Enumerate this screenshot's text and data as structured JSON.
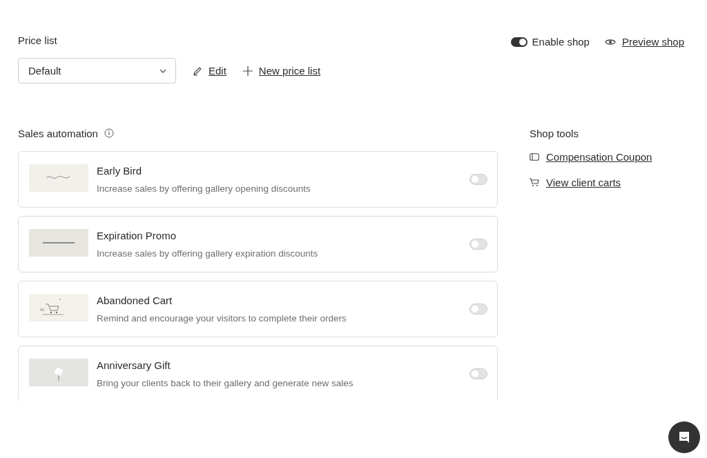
{
  "price_list": {
    "title": "Price list",
    "select": {
      "value": "Default"
    },
    "edit": "Edit",
    "new": "New price list"
  },
  "shop": {
    "enable": {
      "label": "Enable shop",
      "on": true
    },
    "preview": "Preview shop"
  },
  "automation": {
    "title": "Sales automation",
    "items": [
      {
        "title": "Early Bird",
        "description": "Increase sales by offering gallery opening discounts",
        "on": false,
        "kind": "script"
      },
      {
        "title": "Expiration Promo",
        "description": "Increase sales by offering gallery expiration discounts",
        "on": false,
        "kind": "caps"
      },
      {
        "title": "Abandoned Cart",
        "description": "Remind and encourage your visitors to complete their orders",
        "on": false,
        "kind": "cart"
      },
      {
        "title": "Anniversary Gift",
        "description": "Bring your clients back to their gallery and generate new sales",
        "on": false,
        "kind": "flower"
      }
    ]
  },
  "shop_tools": {
    "title": "Shop tools",
    "links": [
      {
        "label": "Compensation Coupon",
        "kind": "coupon"
      },
      {
        "label": "View client carts",
        "kind": "cart"
      }
    ]
  }
}
